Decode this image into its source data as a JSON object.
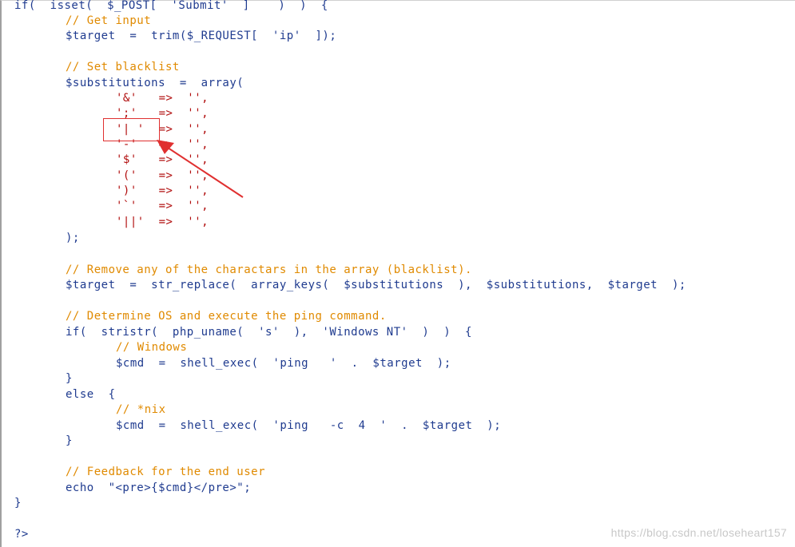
{
  "lines": [
    {
      "t": "if(  isset(  $_POST[  'Submit'  ]    )  )  {"
    },
    {
      "t": "// Get input"
    },
    {
      "t": "$target  =  trim($_REQUEST[  'ip'  ]);"
    },
    {
      "t": "// Set blacklist"
    },
    {
      "t": "$substitutions  =  array("
    },
    {
      "t": "'&'   =>  '',"
    },
    {
      "t": "';'   =>  '',"
    },
    {
      "t": "'| '  =>  '',"
    },
    {
      "t": "'-'   =>  '',"
    },
    {
      "t": "'$'   =>  '',"
    },
    {
      "t": "'('   =>  '',"
    },
    {
      "t": "')'   =>  '',"
    },
    {
      "t": "'`'   =>  '',"
    },
    {
      "t": "'||'  =>  '',"
    },
    {
      "t": ");"
    },
    {
      "t": "// Remove any of the charactars in the array (blacklist)."
    },
    {
      "t": "$target  =  str_replace(  array_keys(  $substitutions  ),  $substitutions,  $target  );"
    },
    {
      "t": "// Determine OS and execute the ping command."
    },
    {
      "t": "if(  stristr(  php_uname(  's'  ),  'Windows NT'  )  )  {"
    },
    {
      "t": "// Windows"
    },
    {
      "t": "$cmd  =  shell_exec(  'ping   '  .  $target  );"
    },
    {
      "t": "}"
    },
    {
      "t": "else  {"
    },
    {
      "t": "// *nix"
    },
    {
      "t": "$cmd  =  shell_exec(  'ping   -c  4  '  .  $target  );"
    },
    {
      "t": "}"
    },
    {
      "t": "// Feedback for the end user"
    },
    {
      "t": "echo  \"<pre>{$cmd}</pre>\";"
    },
    {
      "t": "}"
    },
    {
      "t": "?>"
    }
  ],
  "watermark": "https://blog.csdn.net/loseheart157",
  "colors": {
    "keyword": "#1f3b8f",
    "string": "#b10e0e",
    "comment": "#e08a00",
    "annotation": "#e03030"
  }
}
